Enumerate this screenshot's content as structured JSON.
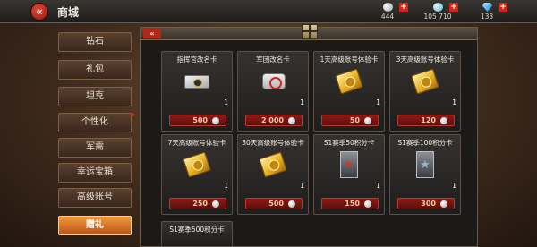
{
  "header": {
    "back_icon": "back-double-chevron-icon",
    "title": "商城",
    "currencies": [
      {
        "icon": "silver-coin-icon",
        "amount": "444"
      },
      {
        "icon": "cyan-coin-icon",
        "amount": "105 710"
      },
      {
        "icon": "diamond-icon",
        "amount": "133"
      }
    ],
    "plus_symbol": "+"
  },
  "sidebar": {
    "items": [
      {
        "label": "钻石",
        "active": false
      },
      {
        "label": "礼包",
        "active": false
      },
      {
        "label": "坦克",
        "active": false
      },
      {
        "label": "个性化",
        "active": false,
        "has_notification": true
      },
      {
        "label": "军需",
        "active": false
      },
      {
        "label": "幸运宝箱",
        "active": false
      },
      {
        "label": "高级账号",
        "active": false
      },
      {
        "label": "赠礼",
        "active": true
      }
    ]
  },
  "panel": {
    "collapse_label": "«",
    "header_icon": "gift-icon",
    "items": [
      {
        "name": "指挥官改名卡",
        "art": "silver-voucher-icon",
        "qty": "1",
        "price": "500"
      },
      {
        "name": "军团改名卡",
        "art": "dog-tag-icon",
        "qty": "1",
        "price": "2 000"
      },
      {
        "name": "1天高级账号体验卡",
        "art": "gold-card-icon",
        "qty": "1",
        "price": "50"
      },
      {
        "name": "3天高级账号体验卡",
        "art": "gold-card-icon",
        "qty": "1",
        "price": "120"
      },
      {
        "name": "7天高级账号体验卡",
        "art": "gold-card-icon",
        "qty": "1",
        "price": "250"
      },
      {
        "name": "30天高级账号体验卡",
        "art": "gold-card-icon",
        "qty": "1",
        "price": "500"
      },
      {
        "name": "S1赛季50积分卡",
        "art": "rank-badge-icon",
        "qty": "1",
        "price": "150"
      },
      {
        "name": "S1赛季100积分卡",
        "art": "rank-badge-blue-icon",
        "qty": "1",
        "price": "300"
      },
      {
        "name": "S1赛季500积分卡"
      }
    ]
  },
  "colors": {
    "accent_red": "#b5261a",
    "active_tab": "#f29a3c",
    "price_bar": "#8d1b16"
  }
}
